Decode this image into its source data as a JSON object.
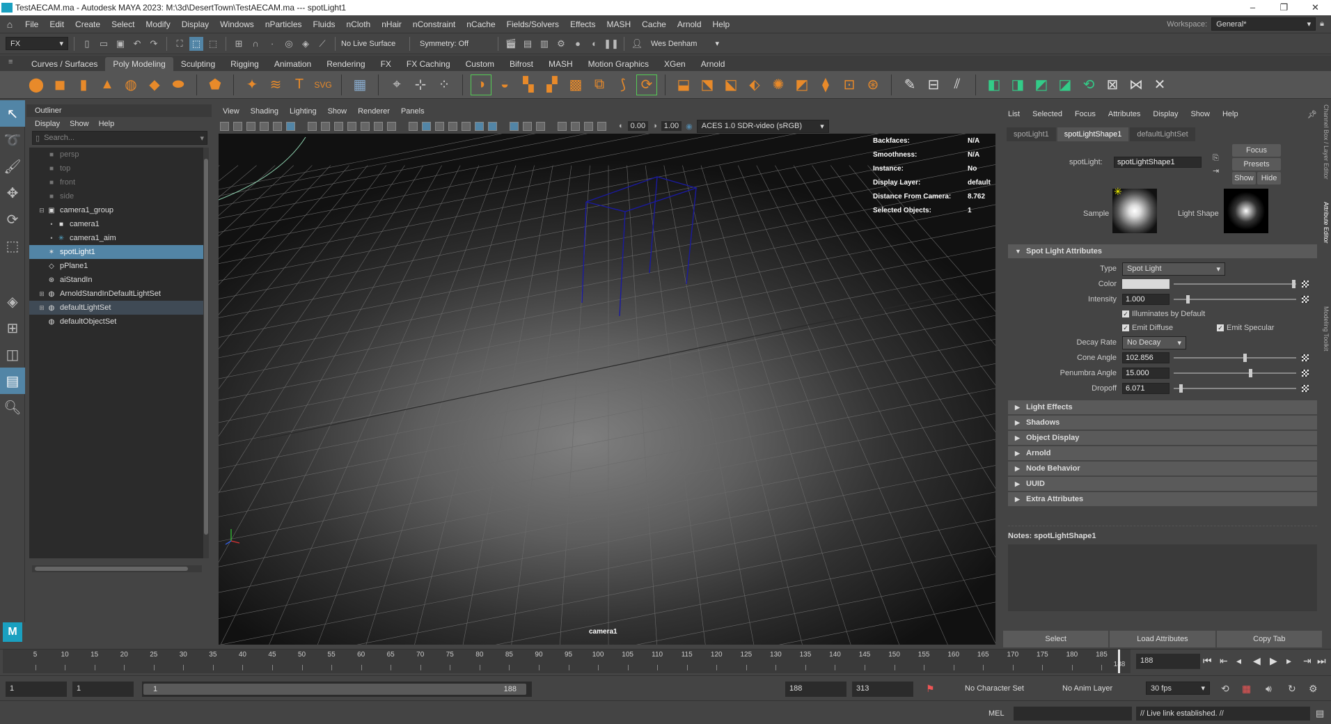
{
  "title_bar": {
    "title": "TestAECAM.ma - Autodesk MAYA 2023: M:\\3d\\DesertTown\\TestAECAM.ma  ---  spotLight1"
  },
  "menubar": {
    "items": [
      "File",
      "Edit",
      "Create",
      "Select",
      "Modify",
      "Display",
      "Windows",
      "nParticles",
      "Fluids",
      "nCloth",
      "nHair",
      "nConstraint",
      "nCache",
      "Fields/Solvers",
      "Effects",
      "MASH",
      "Cache",
      "Arnold",
      "Help"
    ],
    "workspace_label": "Workspace:",
    "workspace_value": "General*"
  },
  "statusline": {
    "mode": "FX",
    "live_surface": "No Live Surface",
    "symmetry": "Symmetry: Off",
    "user": "Wes Denham"
  },
  "shelf": {
    "tabs": [
      "Curves / Surfaces",
      "Poly Modeling",
      "Sculpting",
      "Rigging",
      "Animation",
      "Rendering",
      "FX",
      "FX Caching",
      "Custom",
      "Bifrost",
      "MASH",
      "Motion Graphics",
      "XGen",
      "Arnold"
    ],
    "active_tab": "Poly Modeling"
  },
  "outliner": {
    "title": "Outliner",
    "menu": [
      "Display",
      "Show",
      "Help"
    ],
    "search_placeholder": "Search...",
    "items": [
      {
        "label": "persp",
        "depth": 1,
        "icon": "camera-icon",
        "dim": true
      },
      {
        "label": "top",
        "depth": 1,
        "icon": "camera-icon",
        "dim": true
      },
      {
        "label": "front",
        "depth": 1,
        "icon": "camera-icon",
        "dim": true
      },
      {
        "label": "side",
        "depth": 1,
        "icon": "camera-icon",
        "dim": true
      },
      {
        "label": "camera1_group",
        "depth": 1,
        "icon": "group-icon",
        "expander": "−"
      },
      {
        "label": "camera1",
        "depth": 2,
        "icon": "camera-icon"
      },
      {
        "label": "camera1_aim",
        "depth": 2,
        "icon": "aim-icon"
      },
      {
        "label": "spotLight1",
        "depth": 1,
        "icon": "spotlight-icon",
        "selected": true
      },
      {
        "label": "pPlane1",
        "depth": 1,
        "icon": "mesh-icon"
      },
      {
        "label": "aiStandIn",
        "depth": 1,
        "icon": "standin-icon"
      },
      {
        "label": "ArnoldStandInDefaultLightSet",
        "depth": 1,
        "icon": "set-icon",
        "expander": "+"
      },
      {
        "label": "defaultLightSet",
        "depth": 1,
        "icon": "set-icon",
        "expander": "+",
        "highlight": true
      },
      {
        "label": "defaultObjectSet",
        "depth": 1,
        "icon": "set-icon"
      }
    ]
  },
  "viewport": {
    "menu": [
      "View",
      "Shading",
      "Lighting",
      "Show",
      "Renderer",
      "Panels"
    ],
    "exposure": "0.00",
    "gamma": "1.00",
    "color_space": "ACES 1.0 SDR-video (sRGB)",
    "hud": [
      {
        "label": "Backfaces:",
        "value": "N/A"
      },
      {
        "label": "Smoothness:",
        "value": "N/A"
      },
      {
        "label": "Instance:",
        "value": "No"
      },
      {
        "label": "Display Layer:",
        "value": "default"
      },
      {
        "label": "Distance From Camera:",
        "value": "8.762"
      },
      {
        "label": "Selected Objects:",
        "value": "1"
      }
    ],
    "camera_label": "camera1"
  },
  "attribute_editor": {
    "menu": [
      "List",
      "Selected",
      "Focus",
      "Attributes",
      "Display",
      "Show",
      "Help"
    ],
    "tabs": [
      "spotLight1",
      "spotLightShape1",
      "defaultLightSet"
    ],
    "active_tab": "spotLightShape1",
    "node_label": "spotLight:",
    "node_name": "spotLightShape1",
    "buttons": {
      "focus": "Focus",
      "presets": "Presets",
      "show": "Show",
      "hide": "Hide"
    },
    "sample_label": "Sample",
    "light_shape_label": "Light Shape",
    "section_title": "Spot Light Attributes",
    "type_label": "Type",
    "type_value": "Spot Light",
    "color_label": "Color",
    "color_value": "#d9d9d9",
    "intensity_label": "Intensity",
    "intensity_value": "1.000",
    "illuminates_label": "Illuminates by Default",
    "emit_diffuse_label": "Emit Diffuse",
    "emit_specular_label": "Emit Specular",
    "decay_label": "Decay Rate",
    "decay_value": "No Decay",
    "cone_label": "Cone Angle",
    "cone_value": "102.856",
    "penumbra_label": "Penumbra Angle",
    "penumbra_value": "15.000",
    "dropoff_label": "Dropoff",
    "dropoff_value": "6.071",
    "collapsed_sections": [
      "Light Effects",
      "Shadows",
      "Object Display",
      "Arnold",
      "Node Behavior",
      "UUID",
      "Extra Attributes"
    ],
    "notes_label": "Notes:  spotLightShape1",
    "bottom_buttons": [
      "Select",
      "Load Attributes",
      "Copy Tab"
    ]
  },
  "side_tabs": [
    "Channel Box / Layer Editor",
    "Attribute Editor",
    "Modeling Toolkit"
  ],
  "timeslider": {
    "ticks": [
      "5",
      "10",
      "15",
      "20",
      "25",
      "30",
      "35",
      "40",
      "45",
      "50",
      "55",
      "60",
      "65",
      "70",
      "75",
      "80",
      "85",
      "90",
      "95",
      "100",
      "105",
      "110",
      "115",
      "120",
      "125",
      "130",
      "135",
      "140",
      "145",
      "150",
      "155",
      "160",
      "165",
      "170",
      "175",
      "180",
      "185"
    ],
    "end_tick": "188",
    "current_frame": "188"
  },
  "rangebar": {
    "start": "1",
    "anim_start": "1",
    "range_start": "1",
    "range_end": "188",
    "anim_end": "188",
    "end": "313",
    "character_set": "No Character Set",
    "anim_layer": "No Anim Layer",
    "fps": "30 fps"
  },
  "cmdline": {
    "lang": "MEL",
    "result": "// Live link established. //"
  }
}
